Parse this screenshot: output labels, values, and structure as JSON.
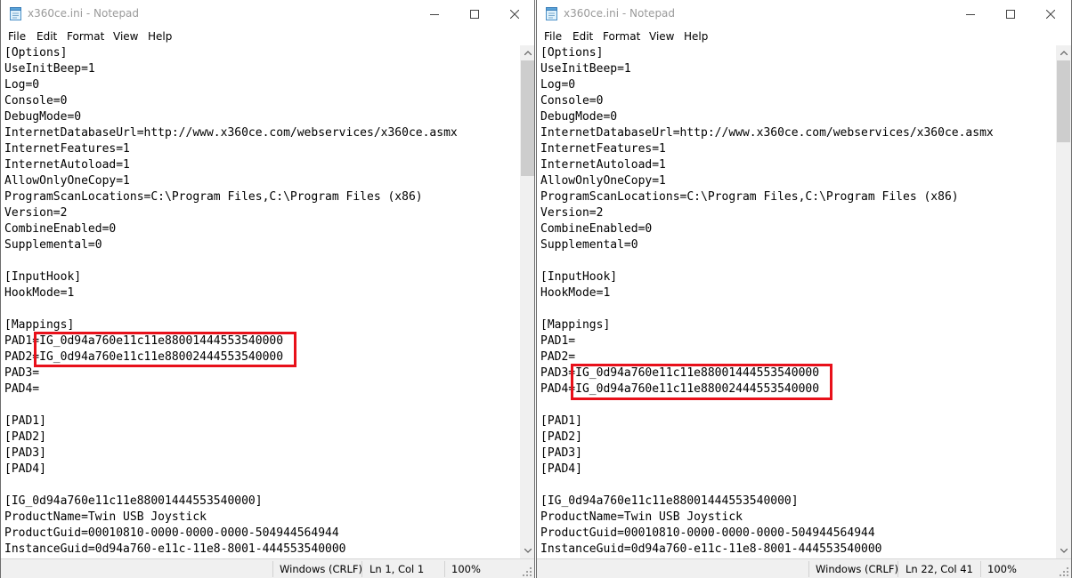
{
  "windows": [
    {
      "title": "x360ce.ini - Notepad",
      "menu": [
        "File",
        "Edit",
        "Format",
        "View",
        "Help"
      ],
      "lines": [
        "[Options]",
        "UseInitBeep=1",
        "Log=0",
        "Console=0",
        "DebugMode=0",
        "InternetDatabaseUrl=http://www.x360ce.com/webservices/x360ce.asmx",
        "InternetFeatures=1",
        "InternetAutoload=1",
        "AllowOnlyOneCopy=1",
        "ProgramScanLocations=C:\\Program Files,C:\\Program Files (x86)",
        "Version=2",
        "CombineEnabled=0",
        "Supplemental=0",
        "",
        "[InputHook]",
        "HookMode=1",
        "",
        "[Mappings]",
        "PAD1=IG_0d94a760e11c11e88001444553540000",
        "PAD2=IG_0d94a760e11c11e88002444553540000",
        "PAD3=",
        "PAD4=",
        "",
        "[PAD1]",
        "[PAD2]",
        "[PAD3]",
        "[PAD4]",
        "",
        "[IG_0d94a760e11c11e88001444553540000]",
        "ProductName=Twin USB Joystick",
        "ProductGuid=00010810-0000-0000-0000-504944564944",
        "InstanceGuid=0d94a760-e11c-11e8-8001-444553540000"
      ],
      "highlight_lines": "PAD1-PAD2",
      "status": {
        "line_ending": "Windows (CRLF)",
        "position": "Ln 1, Col 1",
        "zoom": "100%"
      }
    },
    {
      "title": "x360ce.ini - Notepad",
      "menu": [
        "File",
        "Edit",
        "Format",
        "View",
        "Help"
      ],
      "lines": [
        "[Options]",
        "UseInitBeep=1",
        "Log=0",
        "Console=0",
        "DebugMode=0",
        "InternetDatabaseUrl=http://www.x360ce.com/webservices/x360ce.asmx",
        "InternetFeatures=1",
        "InternetAutoload=1",
        "AllowOnlyOneCopy=1",
        "ProgramScanLocations=C:\\Program Files,C:\\Program Files (x86)",
        "Version=2",
        "CombineEnabled=0",
        "Supplemental=0",
        "",
        "[InputHook]",
        "HookMode=1",
        "",
        "[Mappings]",
        "PAD1=",
        "PAD2=",
        "PAD3=IG_0d94a760e11c11e88001444553540000",
        "PAD4=IG_0d94a760e11c11e88002444553540000",
        "",
        "[PAD1]",
        "[PAD2]",
        "[PAD3]",
        "[PAD4]",
        "",
        "[IG_0d94a760e11c11e88001444553540000]",
        "ProductName=Twin USB Joystick",
        "ProductGuid=00010810-0000-0000-0000-504944564944",
        "InstanceGuid=0d94a760-e11c-11e8-8001-444553540000"
      ],
      "highlight_lines": "PAD3-PAD4",
      "status": {
        "line_ending": "Windows (CRLF)",
        "position": "Ln 22, Col 41",
        "zoom": "100%"
      }
    }
  ],
  "colors": {
    "highlight_border": "#e8101a",
    "title_text": "#9a9a9a",
    "statusbar_bg": "#f0f0f0"
  },
  "icons": [
    "notepad-icon",
    "minimize-icon",
    "maximize-icon",
    "close-icon",
    "scroll-up-arrow-icon",
    "scroll-down-arrow-icon",
    "resize-grip-icon"
  ]
}
